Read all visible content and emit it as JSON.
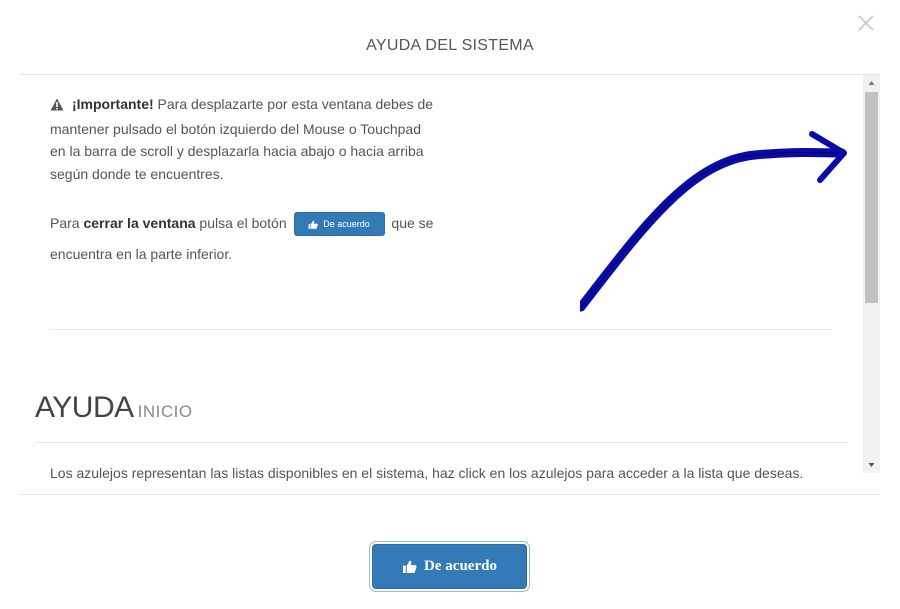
{
  "modal": {
    "title": "AYUDA DEL SISTEMA"
  },
  "notice": {
    "important_label": "¡Importante!",
    "text": " Para desplazarte por esta ventana debes de mantener pulsado el botón izquierdo del Mouse o Touchpad en la barra de scroll y desplazarla hacia abajo o hacia arriba según donde te encuentres."
  },
  "close_instructions": {
    "prefix": "Para ",
    "bold": "cerrar la ventana",
    "middle": " pulsa el botón ",
    "button_label": "De acuerdo",
    "suffix": " que se encuentra en la parte inferior."
  },
  "help": {
    "title": "AYUDA",
    "subtitle": "INICIO",
    "paragraph": "Los azulejos representan las listas disponibles en el sistema, haz click en los azulejos para acceder a la lista que deseas."
  },
  "footer": {
    "ok_label": "De acuerdo"
  },
  "icons": {
    "close": "close-icon",
    "warning": "warning-icon",
    "thumbs_up": "thumbs-up-icon",
    "arrow": "curved-arrow"
  },
  "colors": {
    "primary": "#337ab7",
    "arrow": "#0a0aa8"
  }
}
